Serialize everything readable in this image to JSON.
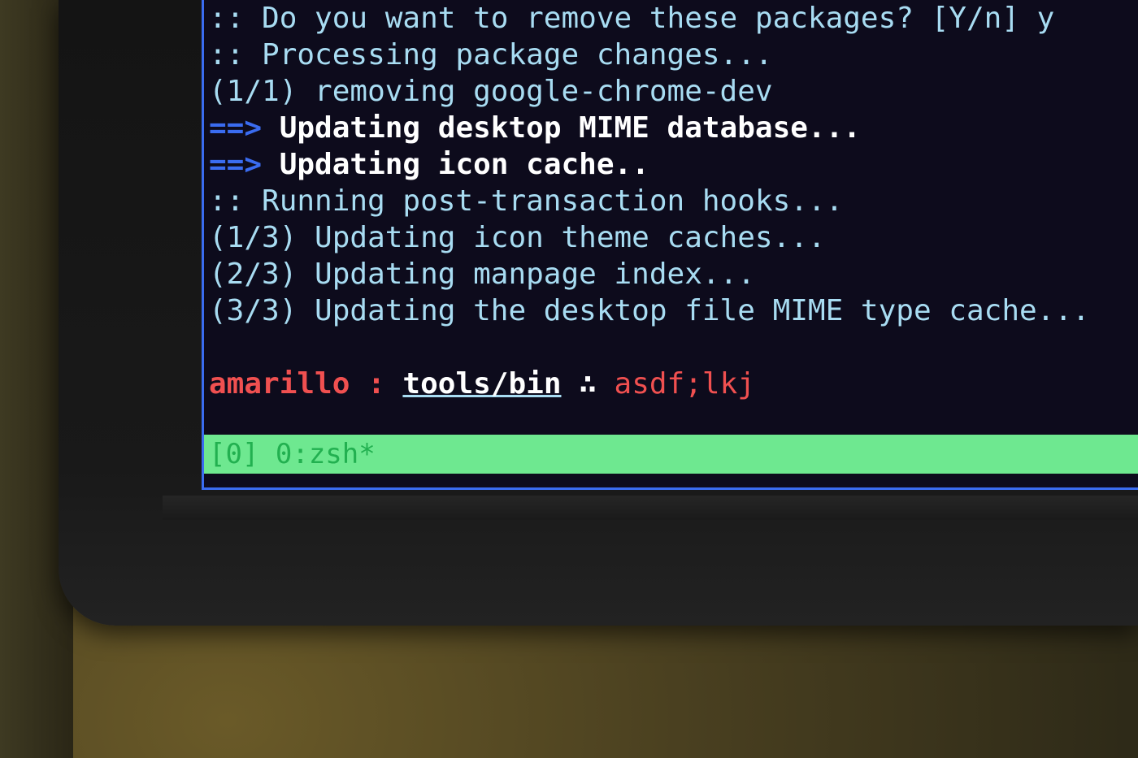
{
  "terminal": {
    "lines": [
      {
        "prefix": "",
        "text": ":: Do you want to remove these packages? [Y/n] y"
      },
      {
        "prefix": "",
        "text": ":: Processing package changes..."
      },
      {
        "prefix": "",
        "text": "(1/1) removing google-chrome-dev"
      },
      {
        "prefix": "==>",
        "text": " Updating desktop MIME database..."
      },
      {
        "prefix": "==>",
        "text": " Updating icon cache.."
      },
      {
        "prefix": "",
        "text": ":: Running post-transaction hooks..."
      },
      {
        "prefix": "",
        "text": "(1/3) Updating icon theme caches..."
      },
      {
        "prefix": "",
        "text": "(2/3) Updating manpage index..."
      },
      {
        "prefix": "",
        "text": "(3/3) Updating the desktop file MIME type cache..."
      }
    ],
    "prompt": {
      "host": "amarillo",
      "separator": " : ",
      "path": "tools/bin",
      "symbol": " ∴ ",
      "input": "asdf;lkj"
    }
  },
  "tmux_status": {
    "text": "[0] 0:zsh*"
  },
  "colors": {
    "background": "#0d0b1c",
    "text": "#a8dcf2",
    "arrow": "#3a6cf0",
    "prompt_red": "#f05050",
    "status_bar": "#6ee890"
  }
}
